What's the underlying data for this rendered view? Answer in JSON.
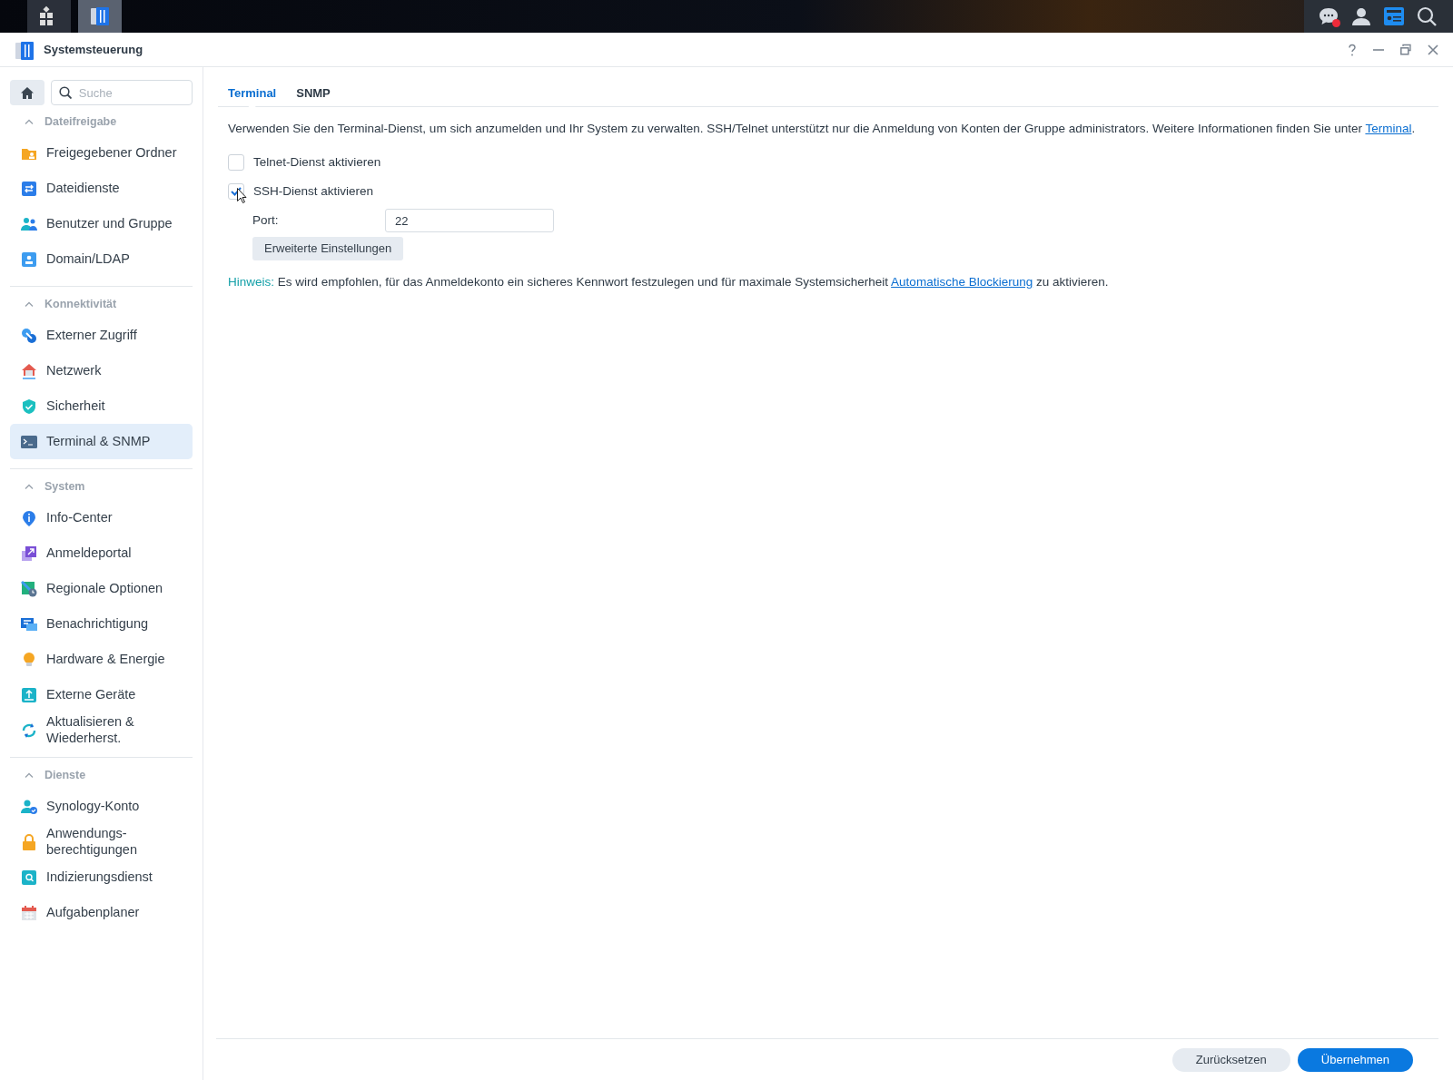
{
  "taskbar": {
    "apps": [
      {
        "selected": false
      },
      {
        "selected": true
      }
    ],
    "notification": true
  },
  "window": {
    "title": "Systemsteuerung"
  },
  "sidebar": {
    "search": {
      "placeholder": "Suche"
    },
    "sections": [
      {
        "title": "Dateifreigabe",
        "expanded": true,
        "items": [
          {
            "label": "Freigegebener Ordner",
            "selected": false
          },
          {
            "label": "Dateidienste",
            "selected": false
          },
          {
            "label": "Benutzer und Gruppe",
            "selected": false
          },
          {
            "label": "Domain/LDAP",
            "selected": false
          }
        ]
      },
      {
        "title": "Konnektivität",
        "expanded": true,
        "items": [
          {
            "label": "Externer Zugriff",
            "selected": false
          },
          {
            "label": "Netzwerk",
            "selected": false
          },
          {
            "label": "Sicherheit",
            "selected": false
          },
          {
            "label": "Terminal & SNMP",
            "selected": true
          }
        ]
      },
      {
        "title": "System",
        "expanded": true,
        "items": [
          {
            "label": "Info-Center",
            "selected": false
          },
          {
            "label": "Anmeldeportal",
            "selected": false
          },
          {
            "label": "Regionale Optionen",
            "selected": false
          },
          {
            "label": "Benachrichtigung",
            "selected": false
          },
          {
            "label": "Hardware & Energie",
            "selected": false
          },
          {
            "label": "Externe Geräte",
            "selected": false
          },
          {
            "label": "Aktualisieren & Wiederherst.",
            "selected": false
          }
        ]
      },
      {
        "title": "Dienste",
        "expanded": true,
        "items": [
          {
            "label": "Synology-Konto",
            "selected": false
          },
          {
            "label": "Anwendungs-berechtigungen",
            "selected": false
          },
          {
            "label": "Indizierungsdienst",
            "selected": false
          },
          {
            "label": "Aufgabenplaner",
            "selected": false
          }
        ]
      }
    ]
  },
  "tabs": [
    {
      "label": "Terminal",
      "selected": true
    },
    {
      "label": "SNMP",
      "selected": false
    }
  ],
  "intro": {
    "text": "Verwenden Sie den Terminal-Dienst, um sich anzumelden und Ihr System zu verwalten. SSH/Telnet unterstützt nur die Anmeldung von Konten der Gruppe administrators. Weitere Informationen finden Sie unter ",
    "link": "Terminal",
    "after": "."
  },
  "checkboxes": [
    {
      "label": "Telnet-Dienst aktivieren",
      "checked": false
    },
    {
      "label": "SSH-Dienst aktivieren",
      "checked": true
    }
  ],
  "port": {
    "label": "Port:",
    "value": "22"
  },
  "advanced_button": "Erweiterte Einstellungen",
  "hint": {
    "label": "Hinweis:",
    "text": " Es wird empfohlen, für das Anmeldekonto ein sicheres Kennwort festzulegen und für maximale Systemsicherheit ",
    "link": "Automatische Blockierung",
    "after": " zu aktivieren."
  },
  "footer": {
    "reset": "Zurücksetzen",
    "apply": "Übernehmen"
  }
}
